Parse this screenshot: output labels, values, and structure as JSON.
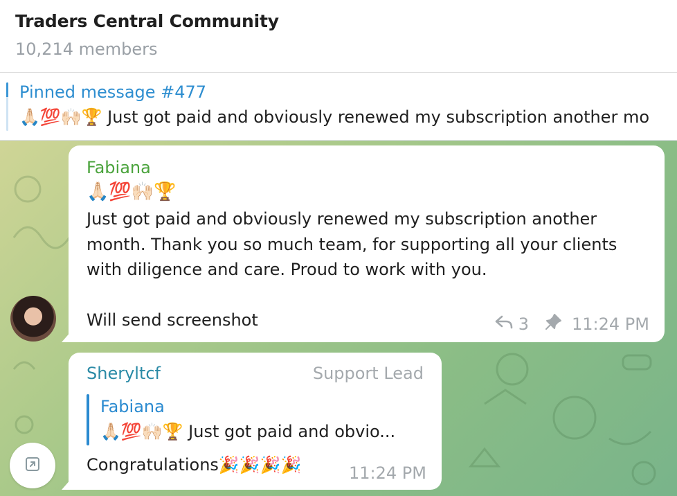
{
  "header": {
    "title": "Traders Central Community",
    "members": "10,214 members"
  },
  "pinned": {
    "title": "Pinned message #477",
    "text": "🙏🏻💯🙌🏻🏆 Just got paid and obviously renewed my subscription another mo"
  },
  "messages": [
    {
      "sender": "Fabiana",
      "emojis": "🙏🏻💯🙌🏻🏆",
      "lines": [
        "Just got paid and obviously renewed my subscription another",
        "month. Thank you so much team, for supporting all your clients",
        "with diligence and care. Proud to work with you."
      ],
      "last_line": "Will send screenshot",
      "replies": "3",
      "time": "11:24 PM"
    },
    {
      "sender": "Sheryltcf",
      "role": "Support Lead",
      "reply_to": {
        "name": "Fabiana",
        "text": "🙏🏻💯🙌🏻🏆 Just got paid and obvio..."
      },
      "text": "Congratulations🎉🎉🎉🎉",
      "time": "11:24 PM"
    }
  ],
  "icons": {
    "reply": "reply-arrow-icon",
    "pin": "pin-icon",
    "scroll": "open-external-icon"
  },
  "colors": {
    "link_blue": "#2e8ed0",
    "fabiana_green": "#4aa33c",
    "sheryl_teal": "#2a8aa6",
    "meta_gray": "#a4a9ad"
  }
}
